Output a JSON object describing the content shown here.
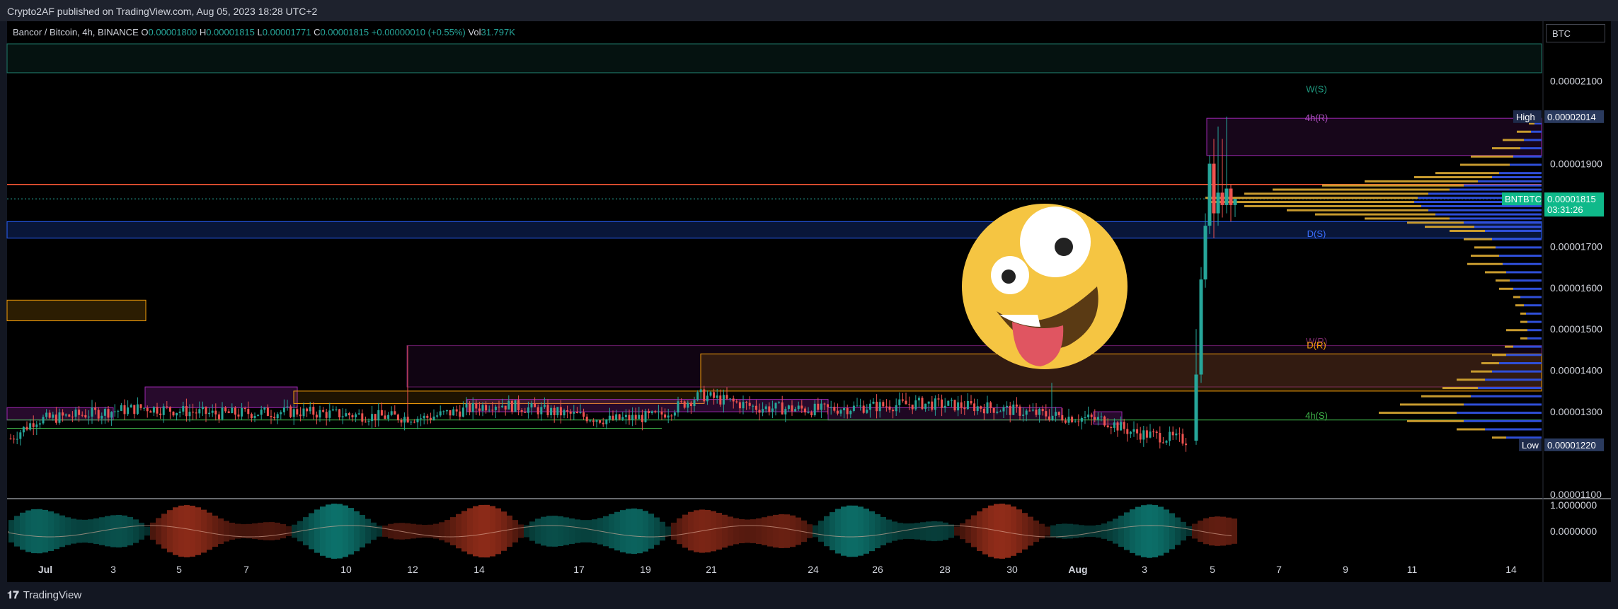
{
  "header": {
    "publish_text": "Crypto2AF published on TradingView.com, Aug 05, 2023 18:28 UTC+2"
  },
  "legend": {
    "symbol": "Bancor / Bitcoin, 4h, BINANCE",
    "o_label": "O",
    "o_value": "0.00001800",
    "h_label": "H",
    "h_value": "0.00001815",
    "l_label": "L",
    "l_value": "0.00001771",
    "c_label": "C",
    "c_value": "0.00001815",
    "change": "+0.00000010 (+0.55%)",
    "vol_label": "Vol",
    "vol_value": "31.797K"
  },
  "currency_box": "BTC",
  "footer": {
    "brand": "TradingView"
  },
  "colors": {
    "up": "#26a69a",
    "down": "#ef5350",
    "up_bright": "#22e3a0",
    "background": "#000000",
    "resistance_line": "#ff5a36",
    "support_zone": "#2962ff",
    "weekly_zone": "#1f7a6a",
    "orange_zone": "#f59e0b",
    "purple_zone": "#9c27b0",
    "volume_profile_gold": "#c89b2e",
    "volume_profile_blue": "#2f4fd8"
  },
  "chart_data": {
    "type": "candlestick",
    "title": "Bancor / Bitcoin, 4h, BINANCE",
    "y_range": [
      1.1e-05,
      2.21e-05
    ],
    "y_ticks": [
      {
        "value": 2.1e-05,
        "label": "0.00002100"
      },
      {
        "value": 1.9e-05,
        "label": "0.00001900"
      },
      {
        "value": 1.7e-05,
        "label": "0.00001700"
      },
      {
        "value": 1.6e-05,
        "label": "0.00001600"
      },
      {
        "value": 1.5e-05,
        "label": "0.00001500"
      },
      {
        "value": 1.4e-05,
        "label": "0.00001400"
      },
      {
        "value": 1.3e-05,
        "label": "0.00001300"
      },
      {
        "value": 1.1e-05,
        "label": "0.00001100"
      }
    ],
    "x_ticks": [
      "Jul",
      "3",
      "5",
      "7",
      "10",
      "12",
      "14",
      "17",
      "19",
      "21",
      "24",
      "26",
      "28",
      "30",
      "Aug",
      "3",
      "5",
      "7",
      "9",
      "11",
      "14"
    ],
    "price_tags": [
      {
        "label": "High",
        "value_text": "0.00002014",
        "value": 2.014e-05
      },
      {
        "label": "BNTBTC",
        "value_text": "0.00001815",
        "value": 1.815e-05,
        "countdown": "03:31:26"
      },
      {
        "label": "Low",
        "value_text": "0.00001220",
        "value": 1.22e-05
      }
    ],
    "zone_labels": [
      {
        "text": "W(S)",
        "value": 2.08e-05
      },
      {
        "text": "4h(R)",
        "value": 2.01e-05
      },
      {
        "text": "D(S)",
        "value": 1.73e-05
      },
      {
        "text": "W(R)",
        "value": 1.47e-05
      },
      {
        "text": "D(R)",
        "value": 1.46e-05
      },
      {
        "text": "4h(S)",
        "value": 1.29e-05
      }
    ],
    "horizontal_lines": [
      {
        "name": "resistance",
        "value": 1.85e-05
      },
      {
        "name": "current",
        "value": 1.815e-05
      }
    ],
    "indicator": {
      "y_ticks": [
        {
          "value": 1.0,
          "label": "1.0000000"
        },
        {
          "value": 0.0,
          "label": "0.0000000"
        }
      ]
    },
    "candles_summary": {
      "range_start": "Jul 1",
      "range_end": "Aug 5",
      "base_level": 1.27e-05,
      "pump_high": 2.014e-05,
      "pre_pump_low": 1.22e-05
    }
  }
}
